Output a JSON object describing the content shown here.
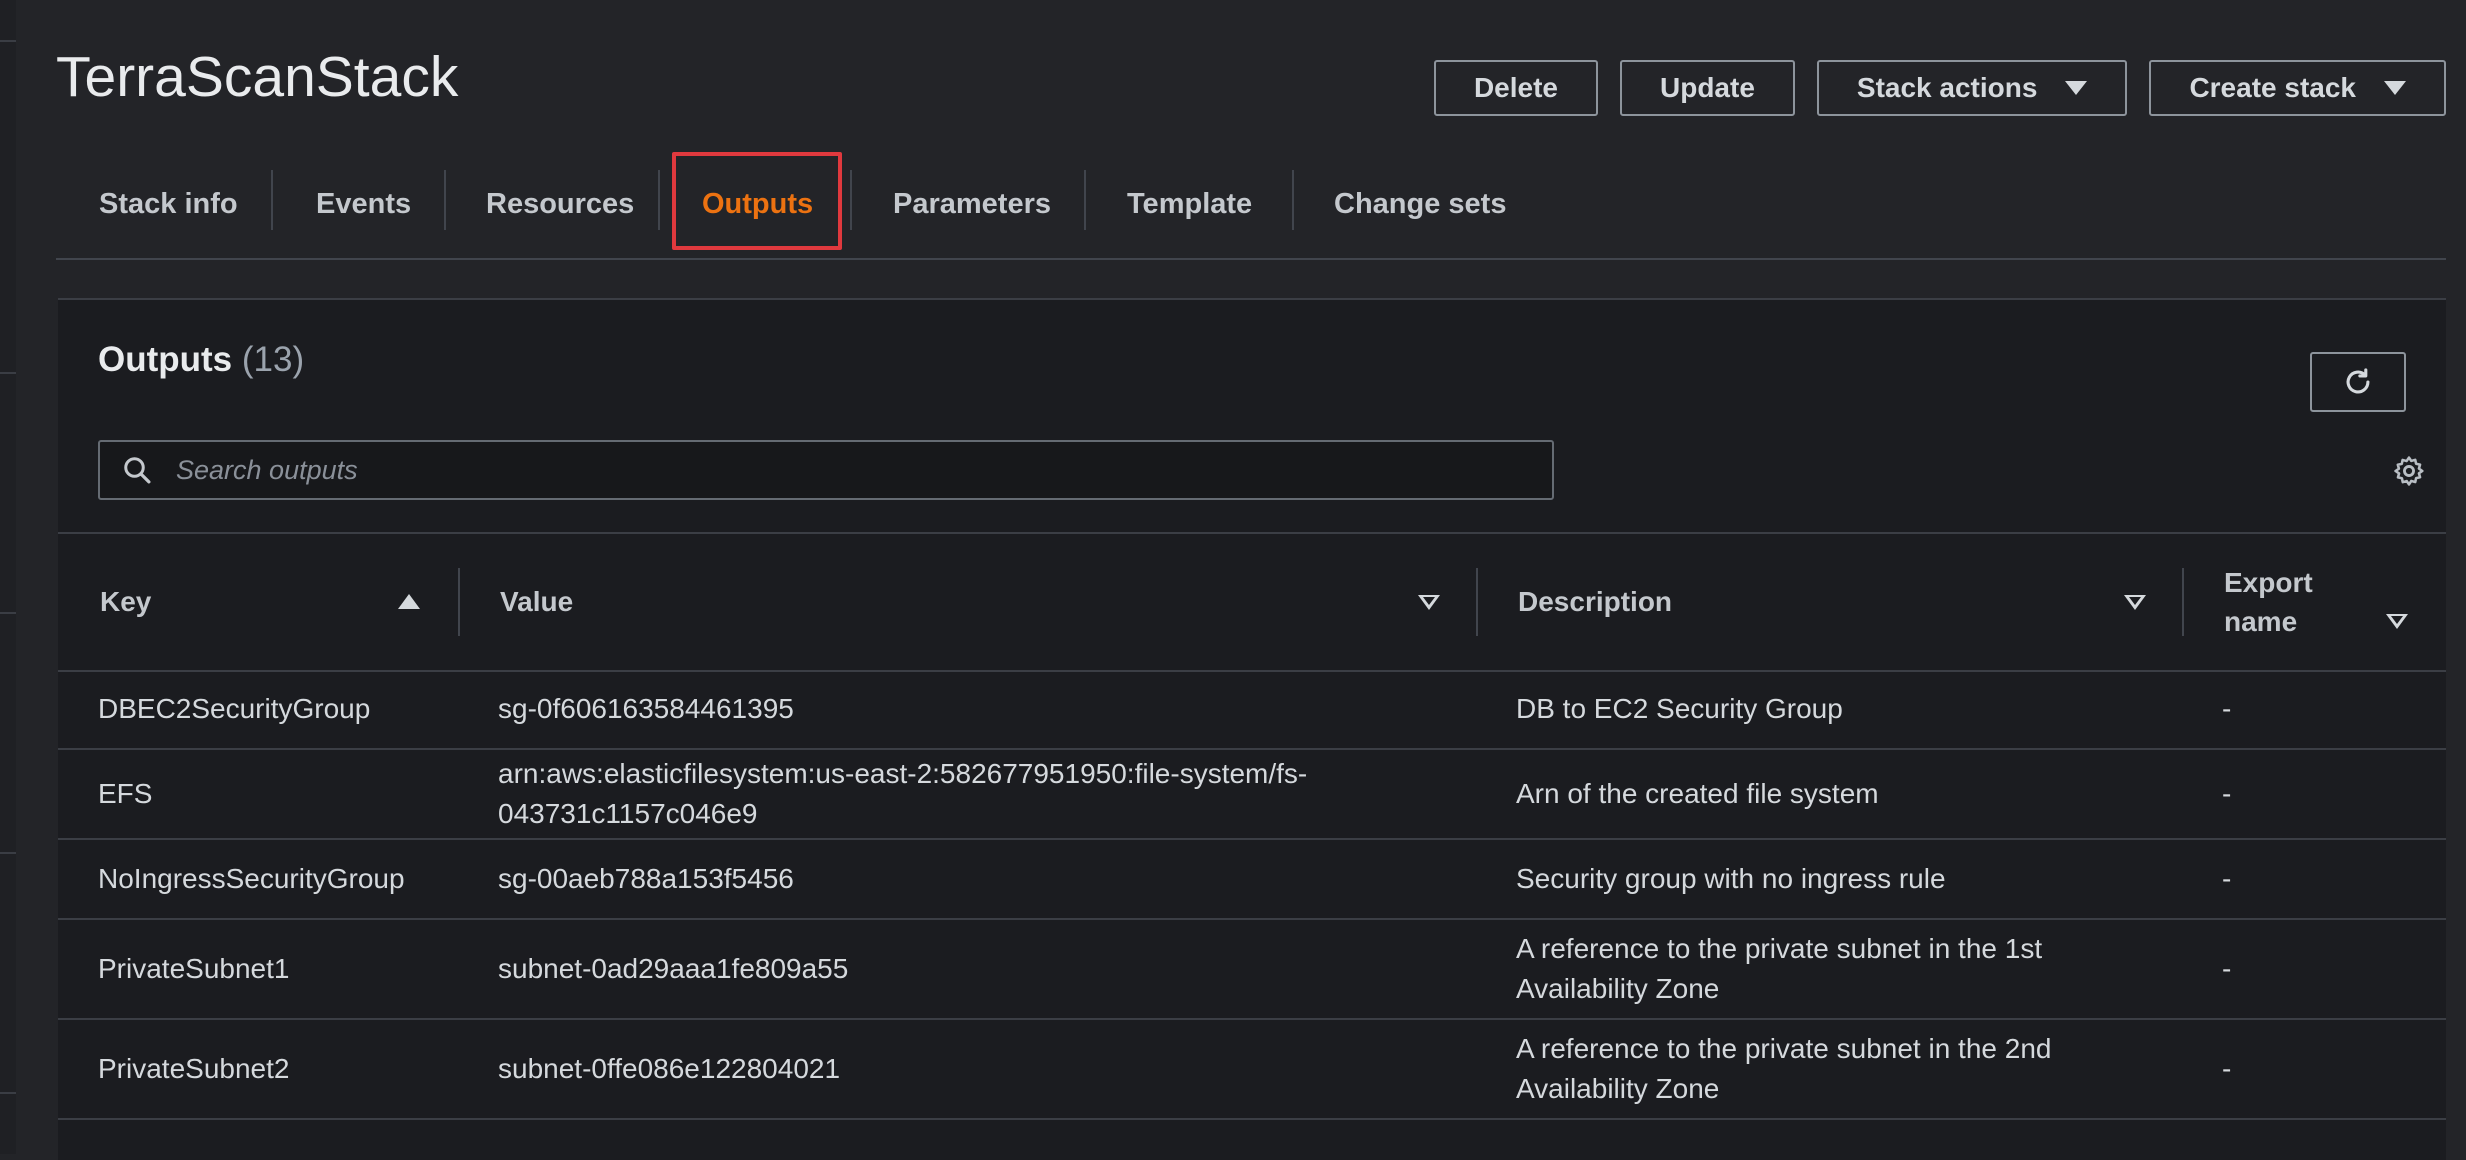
{
  "stack_title": "TerraScanStack",
  "actions": {
    "delete": "Delete",
    "update": "Update",
    "stack_actions": "Stack actions",
    "create_stack": "Create stack"
  },
  "tabs": [
    {
      "label": "Stack info"
    },
    {
      "label": "Events"
    },
    {
      "label": "Resources"
    },
    {
      "label": "Outputs",
      "active": true
    },
    {
      "label": "Parameters"
    },
    {
      "label": "Template"
    },
    {
      "label": "Change sets"
    }
  ],
  "outputs": {
    "heading": "Outputs",
    "count": "(13)",
    "search_placeholder": "Search outputs",
    "columns": {
      "key": "Key",
      "value": "Value",
      "description": "Description",
      "export_name_line1": "Export",
      "export_name_line2": "name"
    },
    "rows": [
      {
        "key": "DBEC2SecurityGroup",
        "value_line1": "sg-0f606163584461395",
        "value_line2": "",
        "desc_line1": "DB to EC2 Security Group",
        "desc_line2": "",
        "export": "-"
      },
      {
        "key": "EFS",
        "value_line1": "arn:aws:elasticfilesystem:us-east-2:582677951950:file-system/fs-",
        "value_line2": "043731c1157c046e9",
        "desc_line1": "Arn of the created file system",
        "desc_line2": "",
        "export": "-"
      },
      {
        "key": "NoIngressSecurityGroup",
        "value_line1": "sg-00aeb788a153f5456",
        "value_line2": "",
        "desc_line1": "Security group with no ingress rule",
        "desc_line2": "",
        "export": "-"
      },
      {
        "key": "PrivateSubnet1",
        "value_line1": "subnet-0ad29aaa1fe809a55",
        "value_line2": "",
        "desc_line1": "A reference to the private subnet in the 1st",
        "desc_line2": "Availability Zone",
        "export": "-"
      },
      {
        "key": "PrivateSubnet2",
        "value_line1": "subnet-0ffe086e122804021",
        "value_line2": "",
        "desc_line1": "A reference to the private subnet in the 2nd",
        "desc_line2": "Availability Zone",
        "export": "-"
      }
    ]
  },
  "colors": {
    "background": "#232428",
    "panel": "#1b1c20",
    "active_tab": "#ec7211",
    "highlight": "#e0393e"
  }
}
